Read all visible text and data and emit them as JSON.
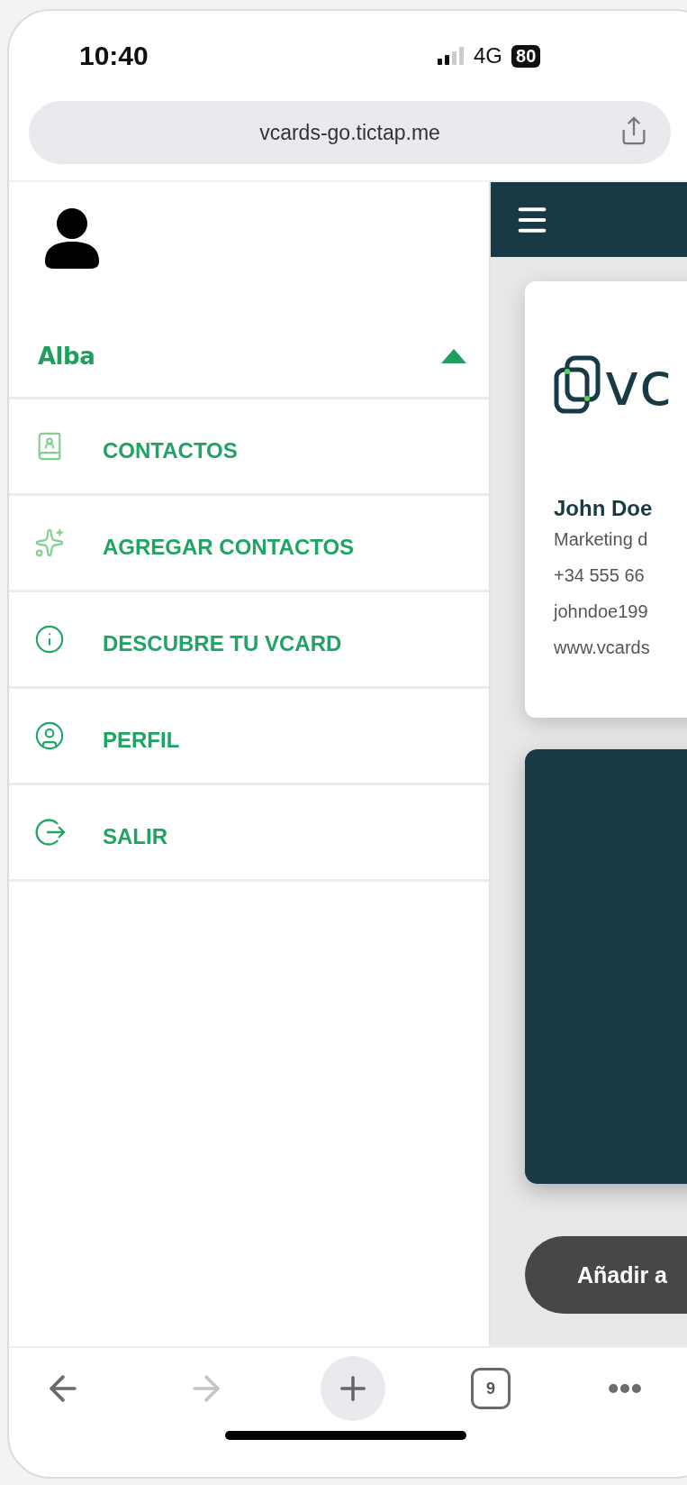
{
  "status_bar": {
    "time": "10:40",
    "network": "4G",
    "battery": "80"
  },
  "browser": {
    "url": "vcards-go.tictap.me"
  },
  "drawer": {
    "user_name": "Alba",
    "expanded": true,
    "items": [
      {
        "label": "CONTACTOS"
      },
      {
        "label": "AGREGAR CONTACTOS"
      },
      {
        "label": "DESCUBRE TU VCARD"
      },
      {
        "label": "PERFIL"
      },
      {
        "label": "SALIR"
      }
    ]
  },
  "card": {
    "logo_text": "vc",
    "name": "John Doe",
    "lines": [
      "Marketing d",
      "+34 555 66",
      "johndoe199",
      "www.vcards"
    ]
  },
  "add_button": "Añadir a",
  "browser_toolbar": {
    "forward_disabled": true,
    "tab_count": "9"
  }
}
